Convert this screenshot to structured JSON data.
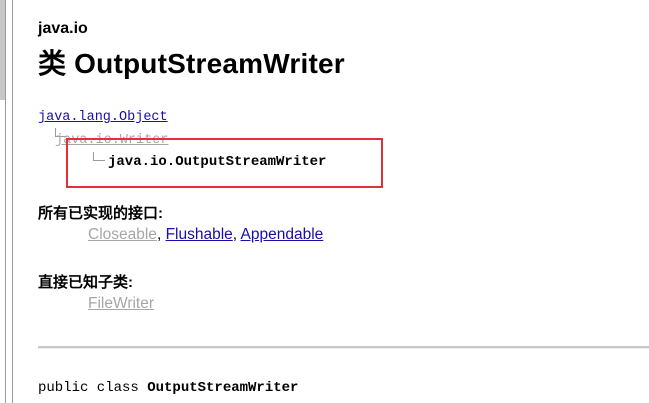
{
  "page": {
    "package_name": "java.io",
    "class_title": "类 OutputStreamWriter"
  },
  "hierarchy": {
    "root": "java.lang.Object",
    "parent": "java.io.Writer",
    "current": "java.io.OutputStreamWriter"
  },
  "interfaces": {
    "heading": "所有已实现的接口:",
    "items": [
      "Closeable",
      "Flushable",
      "Appendable"
    ],
    "separator": ", "
  },
  "subclasses": {
    "heading": "直接已知子类:",
    "items": [
      "FileWriter"
    ]
  },
  "declaration": {
    "prefix": "public class ",
    "name": "OutputStreamWriter"
  },
  "colors": {
    "link": "#1a0dab",
    "visited_link": "#a6a6a6",
    "highlight_box": "#e0303a"
  }
}
